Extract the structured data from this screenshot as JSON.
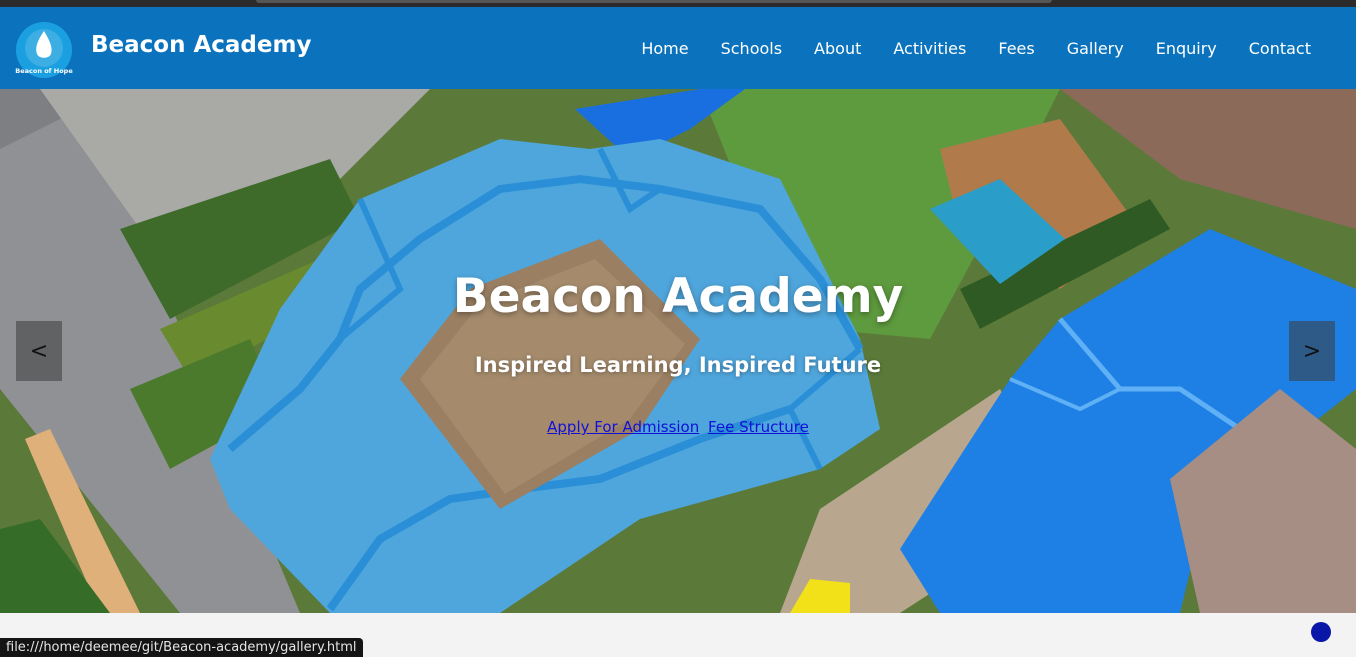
{
  "site": {
    "brand": "Beacon Academy",
    "logo_text": "Beacon of Hope"
  },
  "nav": {
    "items": [
      {
        "label": "Home",
        "name": "nav-home"
      },
      {
        "label": "Schools",
        "name": "nav-schools"
      },
      {
        "label": "About",
        "name": "nav-about"
      },
      {
        "label": "Activities",
        "name": "nav-activities"
      },
      {
        "label": "Fees",
        "name": "nav-fees"
      },
      {
        "label": "Gallery",
        "name": "nav-gallery"
      },
      {
        "label": "Enquiry",
        "name": "nav-enquiry"
      },
      {
        "label": "Contact",
        "name": "nav-contact"
      }
    ]
  },
  "hero": {
    "title": "Beacon Academy",
    "subtitle": "Inspired Learning, Inspired Future",
    "apply_link": "Apply For Admission",
    "fees_link": "Fee Structure",
    "prev_label": "<",
    "next_label": ">"
  },
  "statusbar": {
    "url": "file:///home/deemee/git/Beacon-academy/gallery.html"
  },
  "colors": {
    "header": "#0b73be",
    "roof_blue": "#2a8fe0",
    "link": "#1010d8",
    "chat_dot": "#0a16a8"
  }
}
